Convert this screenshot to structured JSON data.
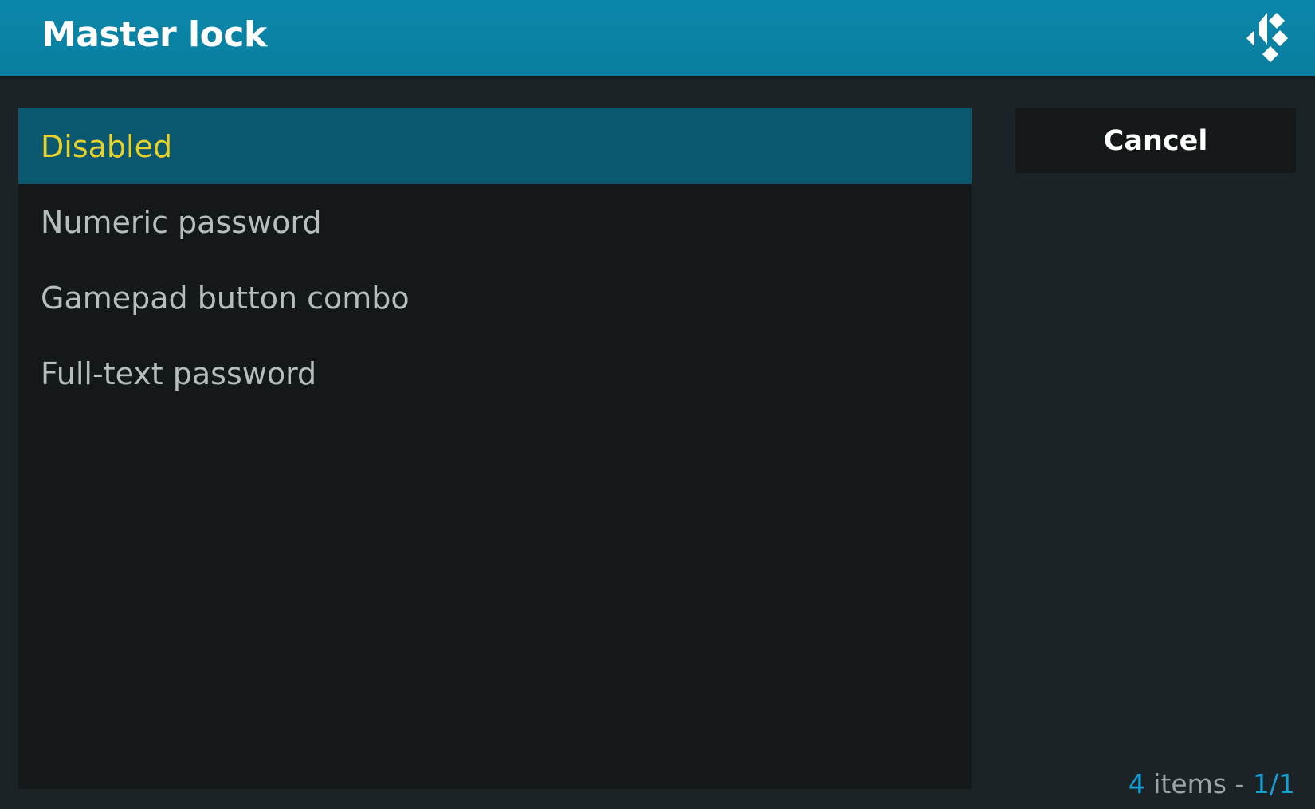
{
  "dialog": {
    "title": "Master lock",
    "logo_icon": "kodi-logo-icon"
  },
  "options": [
    {
      "label": "Disabled",
      "selected": true
    },
    {
      "label": "Numeric password",
      "selected": false
    },
    {
      "label": "Gamepad button combo",
      "selected": false
    },
    {
      "label": "Full-text password",
      "selected": false
    }
  ],
  "buttons": {
    "cancel_label": "Cancel"
  },
  "footer": {
    "count": "4",
    "items_text": " items - ",
    "page": "1/1"
  },
  "colors": {
    "header": "#0a83a6",
    "background": "#1b2326",
    "list_background": "#141819",
    "selected_row": "#0a5870",
    "selected_text": "#e8d12a",
    "item_text": "#b7bcbd",
    "accent": "#12a0d6"
  }
}
